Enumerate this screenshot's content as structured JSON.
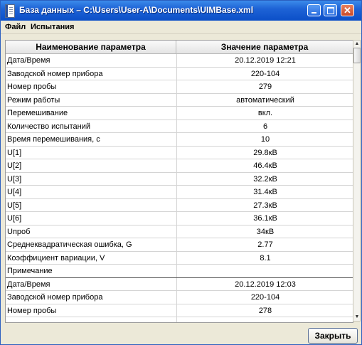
{
  "window": {
    "title": "База данных – C:\\Users\\User-A\\Documents\\UIMBase.xml",
    "minimize": "",
    "maximize": "",
    "close": "✕"
  },
  "menu": {
    "file": "Файл",
    "tests": "Испытания"
  },
  "table": {
    "columns": [
      "Наименование параметра",
      "Значение параметра"
    ],
    "rows": [
      {
        "name": "Дата/Время",
        "value": "20.12.2019 12:21"
      },
      {
        "name": "Заводской номер прибора",
        "value": "220-104"
      },
      {
        "name": "Номер пробы",
        "value": "279"
      },
      {
        "name": "Режим работы",
        "value": "автоматический"
      },
      {
        "name": "Перемешивание",
        "value": "вкл."
      },
      {
        "name": "Количество испытаний",
        "value": "6"
      },
      {
        "name": "Время перемешивания, с",
        "value": "10"
      },
      {
        "name": "U[1]",
        "value": "29.8кВ"
      },
      {
        "name": "U[2]",
        "value": "46.4кВ"
      },
      {
        "name": "U[3]",
        "value": "32.2кВ"
      },
      {
        "name": "U[4]",
        "value": "31.4кВ"
      },
      {
        "name": "U[5]",
        "value": "27.3кВ"
      },
      {
        "name": "U[6]",
        "value": "36.1кВ"
      },
      {
        "name": "Uпроб",
        "value": "34кВ"
      },
      {
        "name": "Среднеквадратическая ошибка, G",
        "value": "2.77"
      },
      {
        "name": "Коэффициент вариации, V",
        "value": "8.1"
      },
      {
        "name": "Примечание",
        "value": ""
      },
      {
        "name": "Дата/Время",
        "value": "20.12.2019 12:03"
      },
      {
        "name": "Заводской номер прибора",
        "value": "220-104"
      },
      {
        "name": "Номер пробы",
        "value": "278"
      },
      {
        "name": "",
        "value": ""
      }
    ]
  },
  "footer": {
    "close_label": "Закрыть"
  }
}
